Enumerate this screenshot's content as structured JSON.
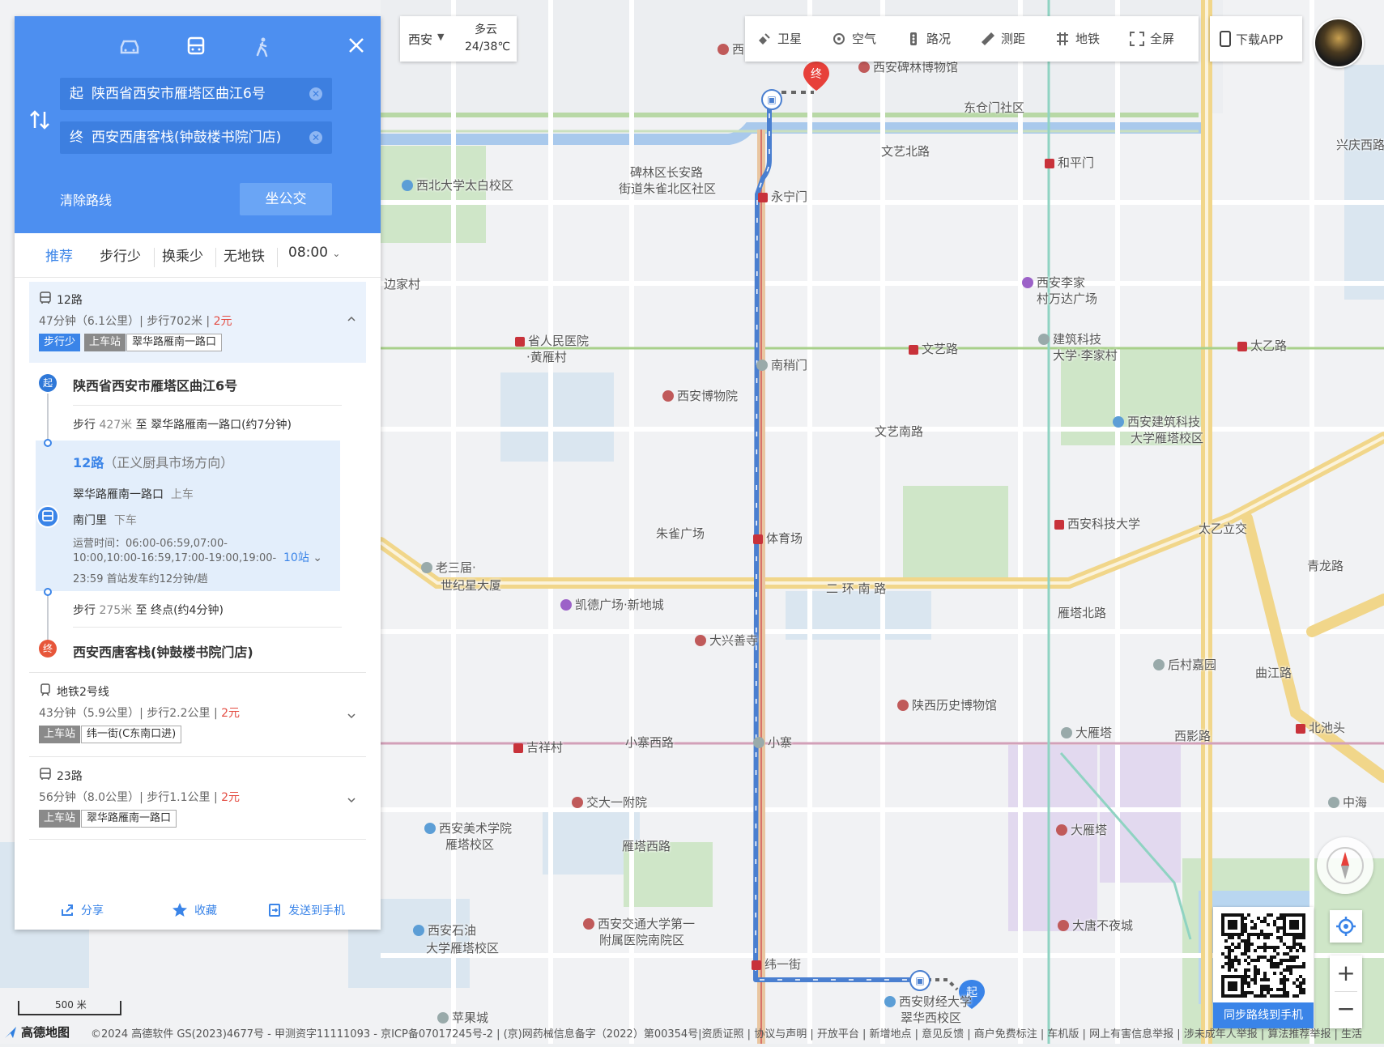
{
  "top_bar": {
    "city": "西安",
    "weather": "多云",
    "temperature": "24/38℃",
    "tools": [
      "卫星",
      "空气",
      "路况",
      "测距",
      "地铁",
      "全屏"
    ],
    "download_app": "下载APP"
  },
  "search": {
    "start_prefix": "起",
    "start": "陕西省西安市雁塔区曲江6号",
    "end_prefix": "终",
    "end": "西安西唐客栈(钟鼓楼书院门店)",
    "clear_route": "清除路线",
    "bus_button": "坐公交"
  },
  "filters": {
    "tabs": [
      "推荐",
      "步行少",
      "换乘少",
      "无地铁"
    ],
    "time": "08:00"
  },
  "routes": [
    {
      "name": "12路",
      "summary": "47分钟（6.1公里）| 步行702米 |",
      "price": "2元",
      "badge": "步行少",
      "board_label": "上车站",
      "board_stop": "翠华路雁南一路口"
    },
    {
      "name": "地铁2号线",
      "summary": "43分钟（5.9公里）| 步行2.2公里 |",
      "price": "2元",
      "board_label": "上车站",
      "board_stop": "纬一街(C东南口进)"
    },
    {
      "name": "23路",
      "summary": "56分钟（8.0公里）| 步行1.1公里 |",
      "price": "2元",
      "board_label": "上车站",
      "board_stop": "翠华路雁南一路口"
    }
  ],
  "detail": {
    "start_mark": "起",
    "start_name": "陕西省西安市雁塔区曲江6号",
    "walk1_pre": "步行",
    "walk1_dist": "427米",
    "walk1_post": "至 翠华路雁南一路口(约7分钟)",
    "bus_line": "12路",
    "bus_dir": "（正义厨具市场方向）",
    "board_stop": "翠华路雁南一路口",
    "board_action": "上车",
    "alight_stop": "南门里",
    "alight_action": "下车",
    "schedule_1": "运营时间：06:00-06:59,07:00-",
    "schedule_2": "10:00,10:00-16:59,17:00-19:00,19:00-",
    "schedule_3": "23:59 首站发车约12分钟/趟",
    "stops": "10站",
    "walk2_pre": "步行",
    "walk2_dist": "275米",
    "walk2_post": "至 终点(约4分钟)",
    "end_mark": "终",
    "end_name": "西安西唐客栈(钟鼓楼书院门店)"
  },
  "actions": {
    "share": "分享",
    "favorite": "收藏",
    "send": "发送到手机"
  },
  "qr_caption": "同步路线到手机",
  "scale": "500 米",
  "logo": "高德地图",
  "footer": "©2024 高德软件 GS(2023)4677号 - 甲测资字11111093 - 京ICP备07017245号-2 | (京)网药械信息备字（2022）第00354号|资质证照 | 协议与声明 | 开放平台 | 新增地点 | 意见反馈 | 商户免费标注 | 车机版 | 网上有害信息举报 | 涉未成年人举报 | 算法推荐举报 | 生活",
  "map_labels": [
    {
      "text": "西安碑林博物馆",
      "type": "poi"
    },
    {
      "text": "东仓门社区",
      "type": "plain"
    },
    {
      "text": "西北大学太白校区",
      "type": "edu"
    },
    {
      "text": "碑林区长安路",
      "type": "plain"
    },
    {
      "text": "街道朱雀北区社区",
      "type": "plain"
    },
    {
      "text": "永宁门",
      "type": "sub"
    },
    {
      "text": "文艺北路",
      "type": "plain"
    },
    {
      "text": "和平门",
      "type": "sub"
    },
    {
      "text": "兴庆西路",
      "type": "plain"
    },
    {
      "text": "边家村",
      "type": "plain"
    },
    {
      "text": "西安李家",
      "type": "mall"
    },
    {
      "text": "村万达广场",
      "type": "plain"
    },
    {
      "text": "省人民医院",
      "type": "sub"
    },
    {
      "text": "·黄雁村",
      "type": "plain"
    },
    {
      "text": "南稍门",
      "type": "gray"
    },
    {
      "text": "文艺路",
      "type": "sub"
    },
    {
      "text": "建筑科技",
      "type": "gray"
    },
    {
      "text": "大学·李家村",
      "type": "plain"
    },
    {
      "text": "太乙路",
      "type": "sub"
    },
    {
      "text": "西安博物院",
      "type": "poi"
    },
    {
      "text": "文艺南路",
      "type": "plain"
    },
    {
      "text": "西安建筑科技",
      "type": "edu"
    },
    {
      "text": "大学雁塔校区",
      "type": "plain"
    },
    {
      "text": "朱雀广场",
      "type": "plain"
    },
    {
      "text": "体育场",
      "type": "sub"
    },
    {
      "text": "西安科技大学",
      "type": "sub"
    },
    {
      "text": "太乙立交",
      "type": "plain"
    },
    {
      "text": "老三届·",
      "type": "gray"
    },
    {
      "text": "世纪星大厦",
      "type": "plain"
    },
    {
      "text": "二 环 南 路",
      "type": "plain"
    },
    {
      "text": "凯德广场·新地城",
      "type": "mall"
    },
    {
      "text": "青龙路",
      "type": "plain"
    },
    {
      "text": "大兴善寺",
      "type": "poi"
    },
    {
      "text": "雁塔北路",
      "type": "plain"
    },
    {
      "text": "后村嘉园",
      "type": "gray"
    },
    {
      "text": "曲江路",
      "type": "plain"
    },
    {
      "text": "陕西历史博物馆",
      "type": "poi"
    },
    {
      "text": "吉祥村",
      "type": "sub"
    },
    {
      "text": "小寨西路",
      "type": "plain"
    },
    {
      "text": "小寨",
      "type": "gray"
    },
    {
      "text": "大雁塔",
      "type": "gray"
    },
    {
      "text": "西影路",
      "type": "plain"
    },
    {
      "text": "北池头",
      "type": "sub"
    },
    {
      "text": "交大一附院",
      "type": "poi"
    },
    {
      "text": "中海",
      "type": "gray"
    },
    {
      "text": "西安美术学院",
      "type": "edu"
    },
    {
      "text": "雁塔校区",
      "type": "plain"
    },
    {
      "text": "雁塔西路",
      "type": "plain"
    },
    {
      "text": "大雁塔",
      "type": "poi"
    },
    {
      "text": "西安交通大学第一",
      "type": "poi"
    },
    {
      "text": "附属医院南院区",
      "type": "plain"
    },
    {
      "text": "大唐不夜城",
      "type": "poi"
    },
    {
      "text": "西安石油",
      "type": "edu"
    },
    {
      "text": "大学雁塔校区",
      "type": "plain"
    },
    {
      "text": "纬一街",
      "type": "sub"
    },
    {
      "text": "西安财经大学",
      "type": "edu"
    },
    {
      "text": "翠华西校区",
      "type": "plain"
    },
    {
      "text": "苹果城",
      "type": "gray"
    },
    {
      "text": "西",
      "type": "poi"
    }
  ],
  "colors": {
    "header_blue": "#4d8ff0",
    "route_blue": "#4a7fd0",
    "accent": "#3a84e8",
    "price_red": "#e34c42",
    "marker_red": "#e7403a"
  }
}
